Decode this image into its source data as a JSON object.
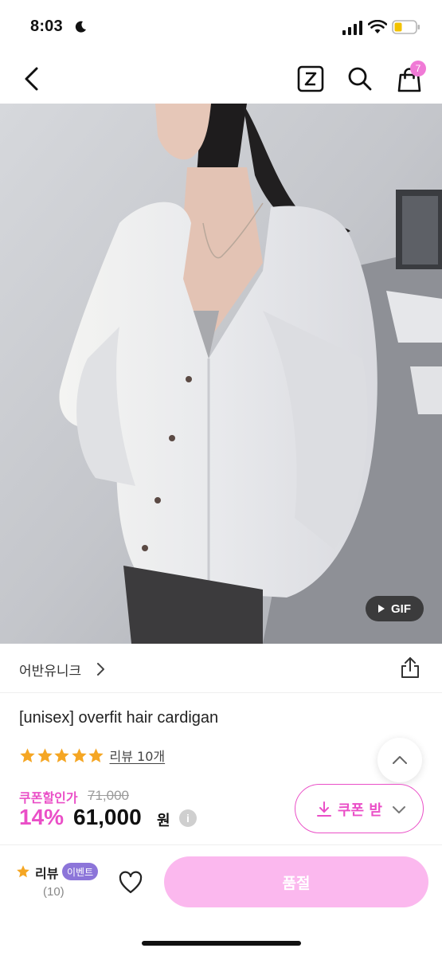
{
  "status_bar": {
    "time": "8:03"
  },
  "nav": {
    "cart_count": "7",
    "z_label": "Z"
  },
  "hero": {
    "gif_label": "GIF"
  },
  "product": {
    "brand": "어반유니크",
    "title": "[unisex] overfit hair cardigan",
    "rating_stars": 5,
    "review_link": "리뷰 10개",
    "coupon_label": "쿠폰할인가",
    "original_price": "71,000",
    "discount": "14%",
    "price": "61,000",
    "currency": "원",
    "info_symbol": "i",
    "coupon_button": "쿠폰 받기"
  },
  "bottom_bar": {
    "review_label": "리뷰",
    "event_badge": "이벤트",
    "review_count": "(10)",
    "soldout_label": "품절"
  },
  "colors": {
    "accent": "#ea4fc7",
    "soldout_bg": "#fbb8ee",
    "event_badge": "#8c75d9",
    "star": "#f5a623"
  }
}
